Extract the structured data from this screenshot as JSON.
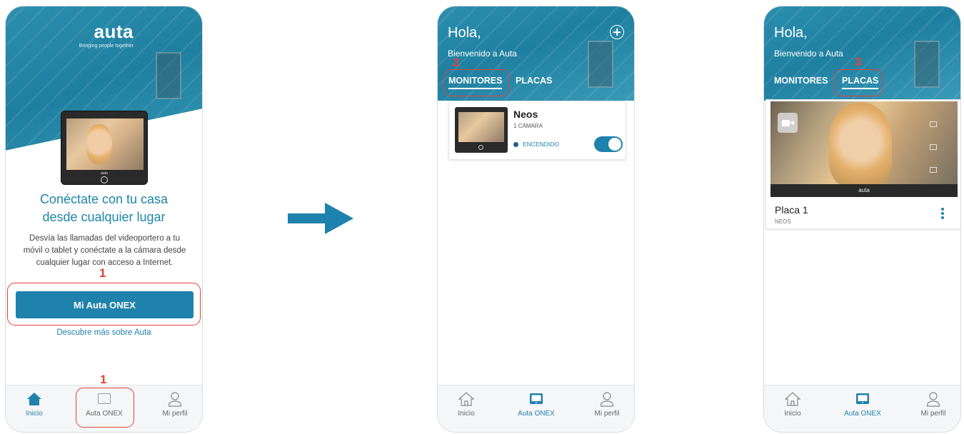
{
  "colors": {
    "primary": "#1f82ac",
    "annotation": "#e4413a",
    "hero": "#2c8fae"
  },
  "screen1": {
    "logo": "auta",
    "tagline": "Bringing people together",
    "device_brand": "auta",
    "headline_line1": "Conéctate con tu casa",
    "headline_line2": "desde cualquier lugar",
    "body_line1": "Desvía las llamadas del videoportero a tu",
    "body_line2": "móvil o tablet y conéctate a la cámara desde",
    "body_line3": "cualquier lugar con acceso a Internet.",
    "step_marker_top": "1",
    "step_marker_bottom": "1",
    "primary_button": "Mi Auta ONEX",
    "link": "Descubre más sobre Auta",
    "tabs": [
      {
        "label": "Inicio",
        "icon": "home-icon",
        "active": true
      },
      {
        "label": "Auta ONEX",
        "icon": "monitor-icon",
        "active": false
      },
      {
        "label": "Mi perfil",
        "icon": "user-icon",
        "active": false
      }
    ]
  },
  "screen2": {
    "greeting": "Hola,",
    "welcome": "Bienvenido a Auta",
    "step_marker": "2",
    "segments": [
      "MONITORES",
      "PLACAS"
    ],
    "active_segment": "MONITORES",
    "card": {
      "name": "Neos",
      "subtitle": "1 CÁMARA",
      "status": "ENCENDIDO",
      "toggle_on": true
    },
    "tabs": [
      {
        "label": "Inicio",
        "icon": "home-icon",
        "active": false
      },
      {
        "label": "Auta ONEX",
        "icon": "monitor-icon",
        "active": true
      },
      {
        "label": "Mi perfil",
        "icon": "user-icon",
        "active": false
      }
    ]
  },
  "screen3": {
    "greeting": "Hola,",
    "welcome": "Bienvenido a Auta",
    "step_marker": "3",
    "segments": [
      "MONITORES",
      "PLACAS"
    ],
    "active_segment": "PLACAS",
    "device_brand": "auta",
    "card": {
      "name": "Placa 1",
      "subtitle": "NEOS"
    },
    "tabs": [
      {
        "label": "Inicio",
        "icon": "home-icon",
        "active": false
      },
      {
        "label": "Auta ONEX",
        "icon": "monitor-icon",
        "active": true
      },
      {
        "label": "Mi perfil",
        "icon": "user-icon",
        "active": false
      }
    ]
  }
}
